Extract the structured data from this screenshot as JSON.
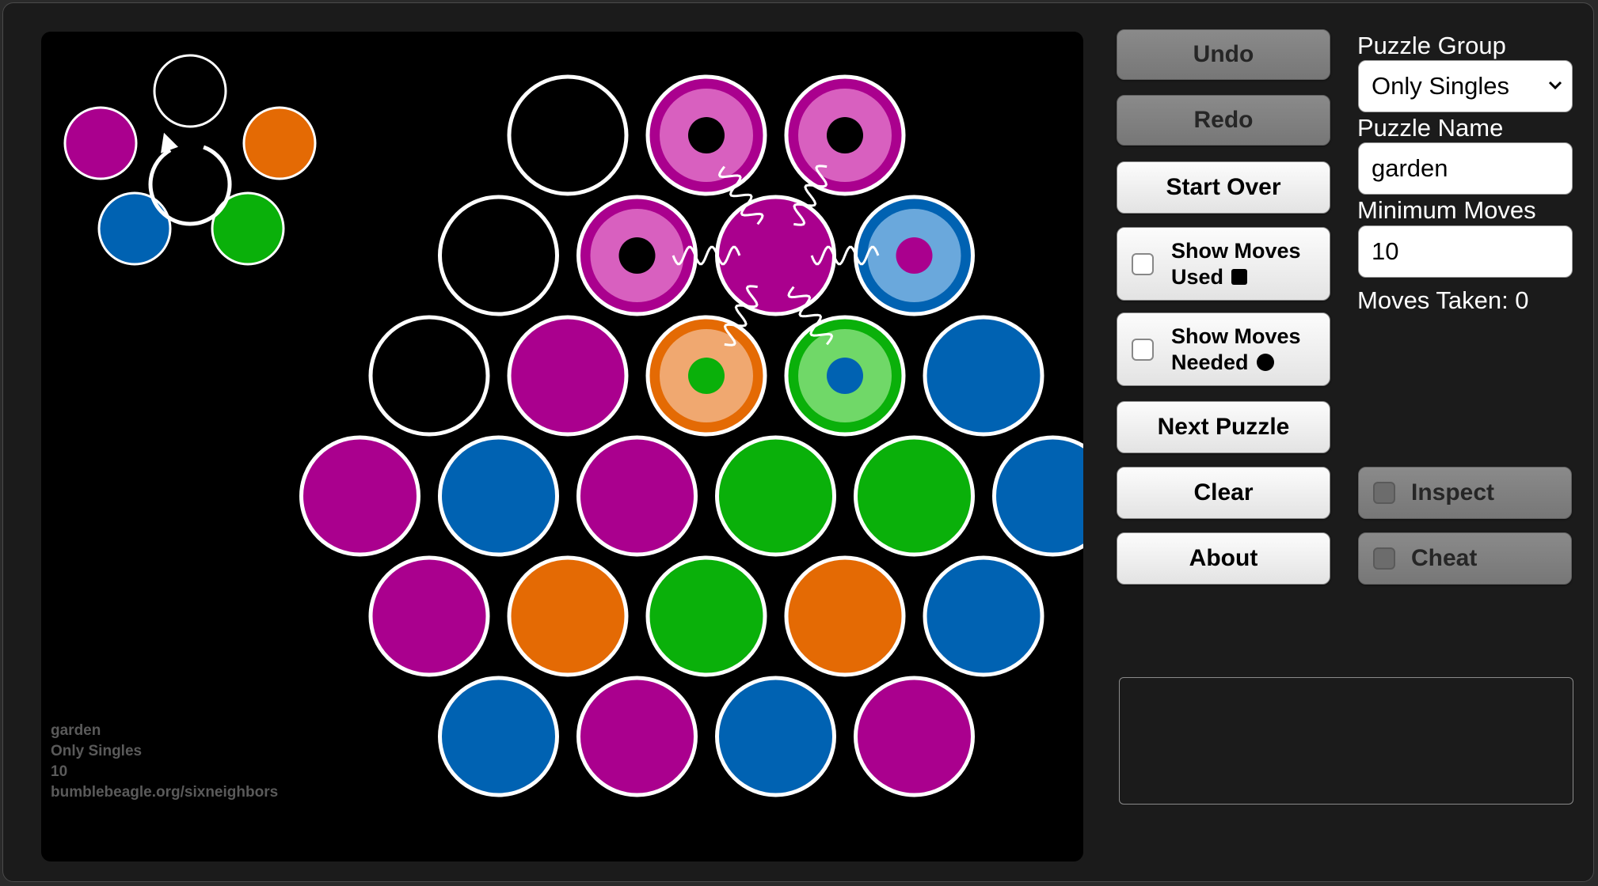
{
  "board": {
    "palette": {
      "black": "#000000",
      "magenta": "#aa008e",
      "orange": "#e46a04",
      "blue": "#0062b2",
      "green": "#0ab00a",
      "light_magenta": "#d860bf",
      "light_orange": "#f0a870",
      "light_blue": "#6aa8dc",
      "light_green": "#70d868",
      "outline": "#ffffff"
    },
    "rows": [
      [
        "black",
        "magenta-target",
        "magenta-target"
      ],
      [
        "black",
        "magenta-target",
        "magenta-source",
        "blue-target"
      ],
      [
        "black",
        "magenta",
        "orange-target",
        "green-target",
        "blue"
      ],
      [
        "magenta",
        "blue",
        "magenta",
        "green",
        "green",
        "blue"
      ],
      [
        "magenta",
        "orange",
        "green",
        "orange",
        "blue"
      ],
      [
        "blue",
        "magenta",
        "blue",
        "magenta"
      ]
    ],
    "cells": {
      "magenta-target": {
        "ring": "magenta",
        "fill": "light_magenta",
        "dot": "black"
      },
      "magenta-source": {
        "fill": "magenta"
      },
      "blue-target": {
        "ring": "blue",
        "fill": "light_blue",
        "dot": "magenta"
      },
      "orange-target": {
        "ring": "orange",
        "fill": "light_orange",
        "dot": "green"
      },
      "green-target": {
        "ring": "green",
        "fill": "light_green",
        "dot": "blue"
      }
    },
    "legend": {
      "icon": "rotate-arrow-icon",
      "colors": [
        "black",
        "orange",
        "green",
        "blue",
        "magenta"
      ]
    },
    "caption": {
      "puzzle_name": "garden",
      "group": "Only Singles",
      "min_moves": "10",
      "site": "bumblebeagle.org/sixneighbors"
    }
  },
  "controls": {
    "undo": "Undo",
    "redo": "Redo",
    "start_over": "Start Over",
    "show_moves_used_line1": "Show Moves",
    "show_moves_used_line2": "Used",
    "show_moves_needed_line1": "Show Moves",
    "show_moves_needed_line2": "Needed",
    "next_puzzle": "Next Puzzle",
    "clear": "Clear",
    "about": "About",
    "inspect": "Inspect",
    "cheat": "Cheat"
  },
  "info": {
    "puzzle_group_label": "Puzzle Group",
    "puzzle_group_value": "Only Singles",
    "puzzle_name_label": "Puzzle Name",
    "puzzle_name_value": "garden",
    "minimum_moves_label": "Minimum Moves",
    "minimum_moves_value": "10",
    "moves_taken": "Moves Taken: 0"
  }
}
